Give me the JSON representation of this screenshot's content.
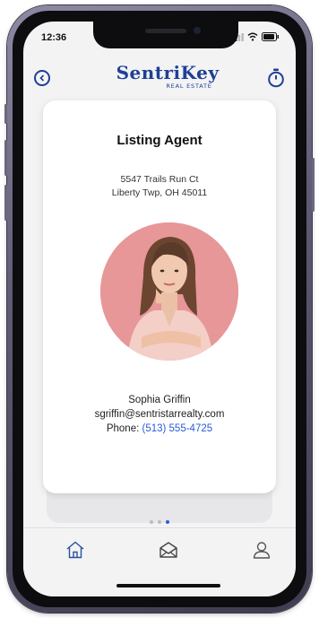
{
  "status": {
    "time": "12:36"
  },
  "brand": {
    "name": "SentriKey",
    "subtitle": "REAL ESTATE",
    "color": "#1f3f95"
  },
  "card": {
    "title": "Listing Agent",
    "address_line1": "5547 Trails Run Ct",
    "address_line2": "Liberty Twp, OH 45011",
    "agent_name": "Sophia Griffin",
    "agent_email": "sgriffin@sentristarrealty.com",
    "phone_label": "Phone:",
    "phone_value": "(513) 555-4725",
    "link_color": "#2a5bd7"
  },
  "pagination": {
    "total": 3,
    "active_index": 2
  },
  "tabs": [
    {
      "name": "home-icon"
    },
    {
      "name": "mail-icon"
    },
    {
      "name": "profile-icon"
    }
  ]
}
